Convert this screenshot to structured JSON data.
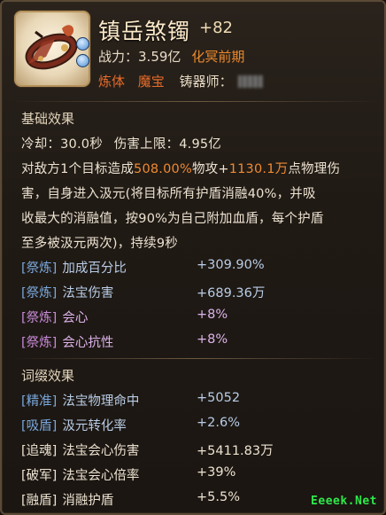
{
  "item": {
    "name": "镇岳煞镯",
    "enhance": "+82",
    "power_label": "战力：",
    "power_value": "3.59亿",
    "realm": "化冥前期",
    "tags": [
      "炼体",
      "魔宝"
    ],
    "smith_label": "铸器师："
  },
  "basic": {
    "title": "基础效果",
    "cooldown_label": "冷却：",
    "cooldown_value": "30.0秒",
    "dmg_cap_label": "伤害上限：",
    "dmg_cap_value": "4.95亿",
    "desc": {
      "l1_a": "对敌方1个目标造成",
      "l1_pct": "508.00%",
      "l1_b": "物攻+",
      "l1_flat": "1130.1万",
      "l1_c": "点物理伤",
      "l2": "害，自身进入汲元(将目标所有护盾消融40%，并吸",
      "l3": "收最大的消融值，按90%为自己附加血盾，每个护盾",
      "l4": "至多被汲元两次)，持续9秒"
    },
    "stats": [
      {
        "tag": "[祭炼]",
        "name": "加成百分比",
        "value": "+309.90%",
        "color": "blue"
      },
      {
        "tag": "[祭炼]",
        "name": "法宝伤害",
        "value": "+689.36万",
        "color": "blue"
      },
      {
        "tag": "[祭炼]",
        "name": "会心",
        "value": "+8%",
        "color": "purple"
      },
      {
        "tag": "[祭炼]",
        "name": "会心抗性",
        "value": "+8%",
        "color": "purple"
      }
    ]
  },
  "affix": {
    "title": "词缀效果",
    "stats": [
      {
        "tag": "[精准]",
        "name": "法宝物理命中",
        "value": "+5052",
        "color": "blue"
      },
      {
        "tag": "[吸盾]",
        "name": "汲元转化率",
        "value": "+2.6%",
        "color": "blue"
      },
      {
        "tag": "[追魂]",
        "name": "法宝会心伤害",
        "value": "+5411.83万",
        "color": "light"
      },
      {
        "tag": "[破军]",
        "name": "法宝会心倍率",
        "value": "+39%",
        "color": "light"
      },
      {
        "tag": "[融盾]",
        "name": "消融护盾",
        "value": "+5.5%",
        "color": "light"
      }
    ]
  },
  "watermark": "Eeeek.Net",
  "colors": {
    "title": "#fbe9c8",
    "orange": "#ef8a33",
    "blue_tag": "#7aa8dc",
    "purple_tag": "#c88ad8",
    "watermark": "#2ee84a"
  },
  "icons": [
    "bracelet-item-icon",
    "info-badge-icon"
  ]
}
